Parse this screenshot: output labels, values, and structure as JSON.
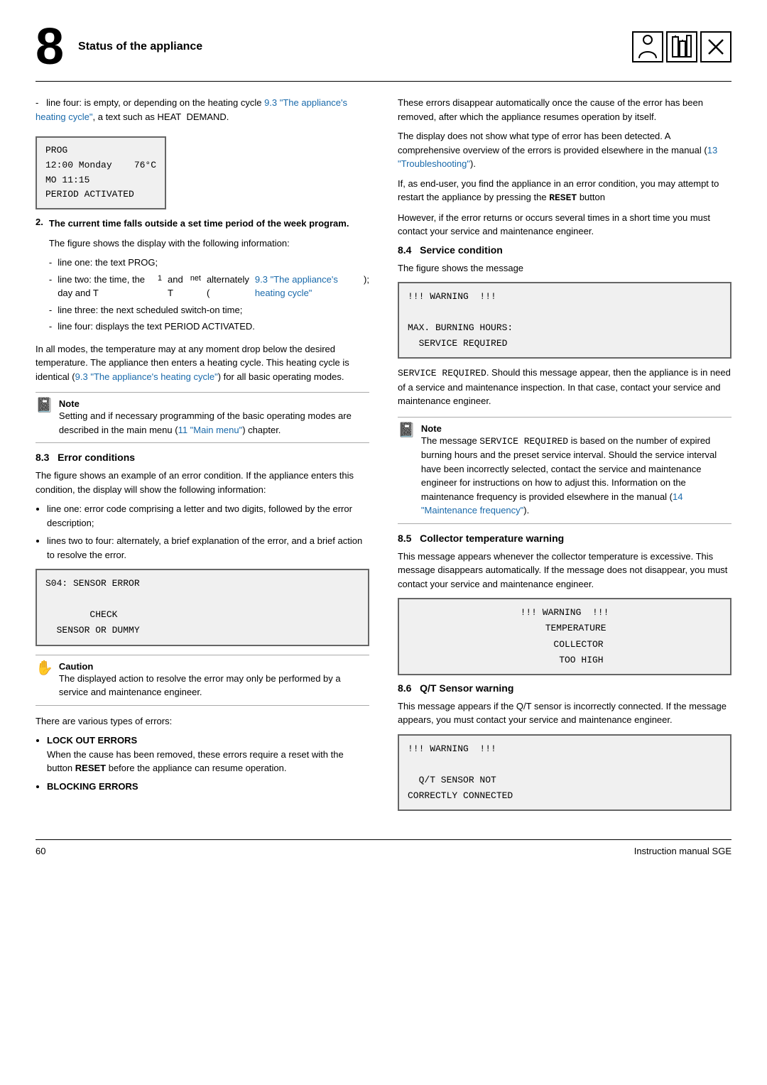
{
  "header": {
    "chapter": "8",
    "title": "Status of the appliance",
    "icons": [
      "👤",
      "⚡",
      "✕"
    ]
  },
  "footer": {
    "page_number": "60",
    "manual_title": "Instruction manual SGE"
  },
  "left_column": {
    "intro_text": "line four: is empty, or depending on the heating cycle ",
    "intro_link": "9.3 \"The appliance's heating cycle\"",
    "intro_suffix": ", a text such as HEAT  DEMAND.",
    "display1": {
      "lines": [
        "PROG",
        "12:00 Monday    76°C",
        "MO 11:15",
        "PERIOD ACTIVATED"
      ]
    },
    "item2_heading": "The current time falls outside a set time period of the week program.",
    "item2_intro": "The figure shows the display with the following information:",
    "dash_items": [
      "line one: the text PROG;",
      "line two: the time, the day and T₁ and T_net alternately (9.3 \"The appliance's heating cycle\");",
      "line three: the next scheduled switch-on time;",
      "line four: displays the text PERIOD ACTIVATED."
    ],
    "all_modes_text": "In all modes, the temperature may at any moment drop below the desired temperature. The appliance then enters a heating cycle. This heating cycle is identical (9.3 \"The appliance's heating cycle\") for all basic operating modes.",
    "note1": {
      "label": "Note",
      "text": "Setting and if necessary programming of the basic operating modes are described in the main menu (11 \"Main menu\") chapter."
    },
    "section83_heading": "8.3   Error conditions",
    "section83_intro": "The figure shows an example of an error condition. If the appliance enters this condition, the display will show the following information:",
    "bullet83": [
      "line one: error code comprising a letter and two digits, followed by the error description;",
      "lines two to four: alternately, a brief explanation of the error, and a brief action to resolve the error."
    ],
    "display83": {
      "lines": [
        "S04: SENSOR ERROR",
        "",
        "        CHECK",
        "  SENSOR OR DUMMY"
      ]
    },
    "caution": {
      "label": "Caution",
      "text": "The displayed action to resolve the error may only be performed by a service and maintenance engineer."
    },
    "errors_intro": "There are various types of errors:",
    "error_types": [
      {
        "name": "LOCK OUT ERRORS",
        "desc": "When the cause has been removed, these errors require a reset with the button RESET before the appliance can resume operation."
      },
      {
        "name": "BLOCKING ERRORS",
        "desc": ""
      }
    ]
  },
  "right_column": {
    "disappear_text": "These errors disappear automatically once the cause of the error has been removed, after which the appliance resumes operation by itself.",
    "display_text": "The display does not show what type of error has been detected. A comprehensive overview of the errors is provided elsewhere in the manual",
    "display_link": "(13 \"Troubleshooting\").",
    "restart_text": "If, as end-user, you find the appliance in an error condition, you may attempt to restart the appliance by pressing the",
    "reset_word": "RESET",
    "restart_suffix": "button",
    "return_text": "However, if the error returns or occurs several times in a short time you must contact your service and maintenance engineer.",
    "section84_heading": "8.4   Service condition",
    "section84_intro": "The figure shows the message",
    "display84": {
      "lines": [
        "!!! WARNING  !!!",
        "",
        "MAX. BURNING HOURS:",
        "  SERVICE REQUIRED"
      ]
    },
    "service_text": "SERVICE REQUIRED. Should this message appear, then the appliance is in need of a service and maintenance inspection. In that case, contact your service and maintenance engineer.",
    "note84": {
      "label": "Note",
      "text": "The message SERVICE REQUIRED is based on the number of expired burning hours and the preset service interval. Should the service interval have been incorrectly selected, contact the service and maintenance engineer for instructions on how to adjust this. Information on the maintenance frequency is provided elsewhere in the manual (14 \"Maintenance frequency\")."
    },
    "section85_heading": "8.5   Collector temperature warning",
    "section85_intro": "This message appears whenever the collector temperature is excessive. This message disappears automatically. If the message does not disappear, you must contact your service and maintenance engineer.",
    "display85": {
      "lines": [
        "!!! WARNING  !!!",
        "    TEMPERATURE",
        "     COLLECTOR",
        "      TOO HIGH"
      ]
    },
    "section86_heading": "8.6   Q/T Sensor warning",
    "section86_intro": "This message appears if the Q/T sensor is incorrectly connected. If the message appears, you must contact your service and maintenance engineer.",
    "display86": {
      "lines": [
        "!!! WARNING  !!!",
        "",
        "  Q/T SENSOR NOT",
        "CORRECTLY CONNECTED"
      ]
    }
  }
}
